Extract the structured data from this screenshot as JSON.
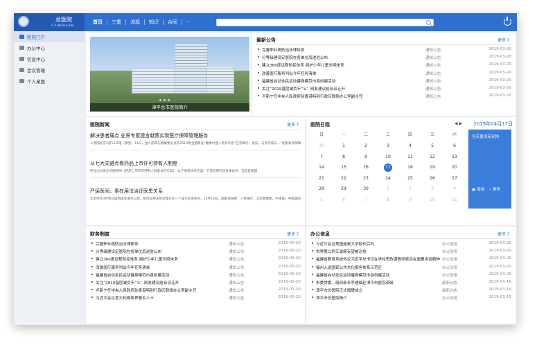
{
  "brand": {
    "name": "总医院",
    "subtitle": "O A 协同办公平台"
  },
  "nav": [
    "首页",
    "三重",
    "流程",
    "知识",
    "合同",
    "···"
  ],
  "search": {
    "placeholder": ""
  },
  "sidebar": [
    {
      "label": "医院门户",
      "icon": "home-icon",
      "active": true
    },
    {
      "label": "办公中心",
      "icon": "briefcase-icon",
      "active": false
    },
    {
      "label": "信息中心",
      "icon": "mail-icon",
      "active": false
    },
    {
      "label": "会议管理",
      "icon": "people-icon",
      "active": false
    },
    {
      "label": "个人桌面",
      "icon": "desktop-icon",
      "active": false
    }
  ],
  "photo": {
    "caption": "漳平总市医院简介"
  },
  "latest": {
    "title": "最新公告",
    "more": "更多 》",
    "items": [
      {
        "text": "完善职业病防治法律体系",
        "source": "通知公告",
        "date": "2019-03-20"
      },
      {
        "text": "分等级建设定医院在各单位后进驻公布",
        "source": "通知公告",
        "date": "2019-03-20"
      },
      {
        "text": "建立360度远程防控体系 网护少年儿童光明未来",
        "source": "通知公告",
        "date": "2019-03-20"
      },
      {
        "text": "改善医疗服务列出今年任务清单",
        "source": "通知公告",
        "date": "2019-03-20"
      },
      {
        "text": "福建省启动全民运动健身模范市县创建活动",
        "source": "通知公告",
        "date": "2019-03-20"
      },
      {
        "text": "关注“2019基层减负年”①：网友建议给会议让开",
        "source": "通知公告",
        "date": "2019-03-20"
      },
      {
        "text": "卢新宁任中央人民政府驻香港特别行政区联络办公室副主任",
        "source": "通知公告",
        "date": "2019-03-20"
      }
    ]
  },
  "hospital_news": {
    "title": "医院新闻",
    "more": "更多 》",
    "items": [
      {
        "headline": "解决患者痛点 业界专家建言献策实现医疗保障管理服务",
        "excerpt": "人民网北京3月14日电（萧皇）14日，由人民网与健康委员会的2019年全国两会“健康中国人民共识会”在京举行，会议，与会专家与...“优质高效保障管理服务 创建国中...【详情】"
      },
      {
        "headline": "从七大关键点看药品上市许可持有人制度",
        "excerpt": "彰显出对关注与期待的《药品上市许可持有人制度试点方案》（以下简称试点方案）于日前颁行这里举试点，这是是我国"
      },
      {
        "headline": "严惩医闹，事在用法治还医患关系",
        "excerpt": "北京时间3月现已医院医生发生以后，如何运用法律治理方式一个成为社会热点。10月16日，国家发展委、人民银行、卫生健康委，中组部、中医医院28部门联合发布《关于对严...【详情】"
      }
    ]
  },
  "calendar": {
    "title": "医院日程",
    "date": "2019年04月17日",
    "weekdays": [
      "日",
      "一",
      "二",
      "三",
      "四",
      "五",
      "六"
    ],
    "weeks": [
      [
        "31",
        "1",
        "2",
        "3",
        "4",
        "5",
        "6"
      ],
      [
        "7",
        "8",
        "9",
        "10",
        "11",
        "12",
        "13"
      ],
      [
        "14",
        "15",
        "16",
        "17",
        "18",
        "19",
        "20"
      ],
      [
        "21",
        "22",
        "23",
        "24",
        "25",
        "26",
        "27"
      ],
      [
        "28",
        "29",
        "30",
        "1",
        "2",
        "3",
        "4"
      ],
      [
        "5",
        "6",
        "7",
        "8",
        "9",
        "10",
        "11"
      ]
    ],
    "today": "17",
    "schedule_empty": "当天暂没有安排",
    "add": "增加",
    "more": "更多"
  },
  "finance": {
    "title": "财务制度",
    "more": "更多 》",
    "items": [
      {
        "text": "完善职业病防治法律体系",
        "source": "通知公告",
        "date": "2019-03-20"
      },
      {
        "text": "分等级建设定医院在各单位后进驻公布",
        "source": "通知公告",
        "date": "2019-03-20"
      },
      {
        "text": "建立360度远程防控体系 网护少年儿童光明未来",
        "source": "通知公告",
        "date": "2019-03-20"
      },
      {
        "text": "改善医疗服务列出今年任务清单",
        "source": "通知公告",
        "date": "2019-03-20"
      },
      {
        "text": "福建省启动全民运动健身模范市县创建活动",
        "source": "通知公告",
        "date": "2019-03-20"
      },
      {
        "text": "关注“2019基层减负年”①：网友建议给会议让开",
        "source": "通知公告",
        "date": "2019-03-20"
      },
      {
        "text": "卢新宁任中央人民政府驻香港特别行政区联络办公室副主任",
        "source": "通知公告",
        "date": "2019-03-20"
      },
      {
        "text": "习近平会见意大利媒体界著名人士",
        "source": "通知公告",
        "date": "2019-03-20"
      }
    ]
  },
  "office": {
    "title": "办公信息",
    "more": "更多 》",
    "items": [
      {
        "text": "习近平会见美国迪奥大学校长后科",
        "source": "办公信息",
        "date": "2019-03-20"
      },
      {
        "text": "世界第二例艾滋病有望被治愈",
        "source": "办公信息",
        "date": "2019-03-20"
      },
      {
        "text": "福建省教育系统热议习近平总书记在学校思政课教师座谈会重要讲话精神",
        "source": "办公信息",
        "date": "2019-03-20"
      },
      {
        "text": "福州入选国家公共文化服务体系示范区",
        "source": "办公信息",
        "date": "2019-03-20"
      },
      {
        "text": "福建省启动全民运动健身模范市县创建活动",
        "source": "办公信息",
        "date": "2019-03-20"
      },
      {
        "text": "市委常委、组织部长李建斌赴漳平市医院调研",
        "source": "最新动态",
        "date": "2019-03-19"
      },
      {
        "text": "漳平市总医院正式揭牌成立",
        "source": "最新动态",
        "date": "2019-03-19"
      },
      {
        "text": "漳平市总医院简介",
        "source": "办公信息",
        "date": "2019-03-19"
      }
    ]
  }
}
